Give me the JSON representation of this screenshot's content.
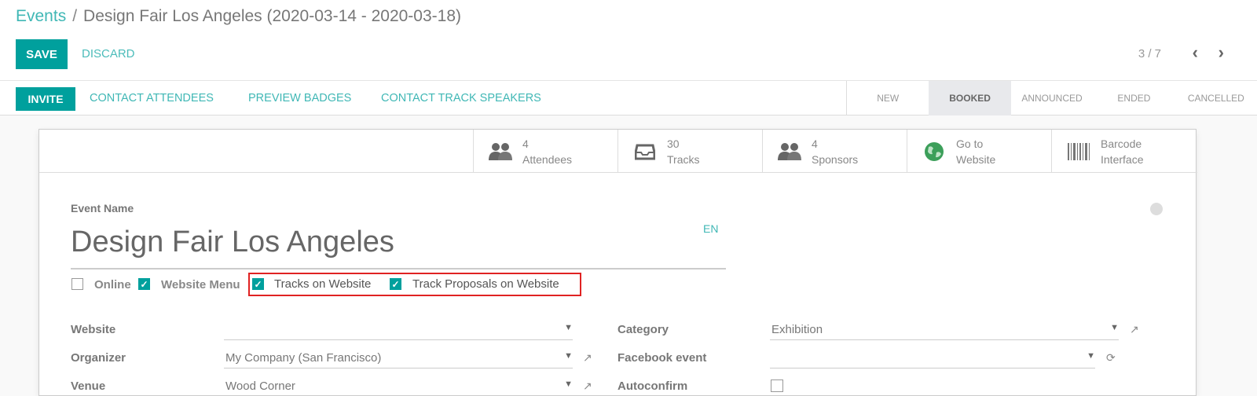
{
  "breadcrumb": {
    "root": "Events",
    "separator": "/",
    "current": "Design Fair Los Angeles (2020-03-14 - 2020-03-18)"
  },
  "buttons": {
    "save": "SAVE",
    "discard": "DISCARD",
    "invite": "INVITE"
  },
  "pager": {
    "value": "3 / 7",
    "prev": "‹",
    "next": "›"
  },
  "actions": [
    "CONTACT ATTENDEES",
    "PREVIEW BADGES",
    "CONTACT TRACK SPEAKERS"
  ],
  "stages": [
    "NEW",
    "BOOKED",
    "ANNOUNCED",
    "ENDED",
    "CANCELLED"
  ],
  "active_stage": "BOOKED",
  "stat_buttons": [
    {
      "icon": "users-icon",
      "line1": "4",
      "line2": "Attendees"
    },
    {
      "icon": "inbox-icon",
      "line1": "30",
      "line2": "Tracks"
    },
    {
      "icon": "users-icon",
      "line1": "4",
      "line2": "Sponsors"
    },
    {
      "icon": "globe-icon",
      "line1": "Go to",
      "line2": "Website"
    },
    {
      "icon": "barcode-icon",
      "line1": "Barcode",
      "line2": "Interface"
    }
  ],
  "form": {
    "event_name_label": "Event Name",
    "event_name": "Design Fair Los Angeles",
    "lang": "EN",
    "checkboxes": [
      {
        "label": "Online",
        "checked": false
      },
      {
        "label": "Website Menu",
        "checked": true
      },
      {
        "label": "Tracks on Website",
        "checked": true
      },
      {
        "label": "Track Proposals on Website",
        "checked": true
      }
    ],
    "fields_left": [
      {
        "label": "Website",
        "value": ""
      },
      {
        "label": "Organizer",
        "value": "My Company (San Francisco)"
      },
      {
        "label": "Venue",
        "value": "Wood Corner"
      }
    ],
    "fields_right": [
      {
        "label": "Category",
        "value": "Exhibition"
      },
      {
        "label": "Facebook event",
        "value": ""
      },
      {
        "label": "Autoconfirm",
        "value": ""
      }
    ]
  },
  "colors": {
    "accent": "#00a09d",
    "highlight": "#e02222"
  }
}
